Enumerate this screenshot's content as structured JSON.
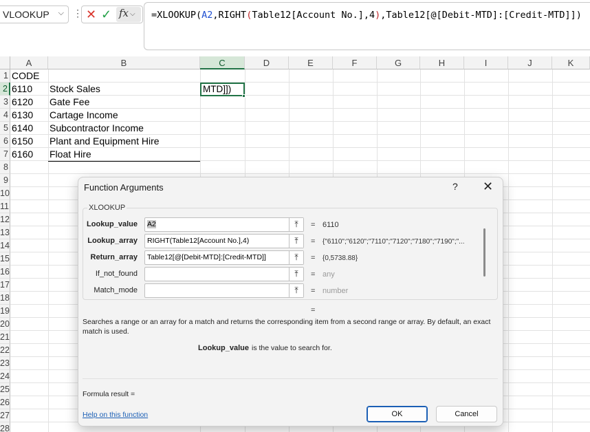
{
  "formula_bar": {
    "name_box": "VLOOKUP",
    "fx_label": "fx",
    "formula": {
      "p1": "=XLOOKUP(",
      "p2": "A2",
      "p3": ",RIGHT",
      "p4": "(",
      "p5": "Table12[Account No.],4",
      "p6": ")",
      "p7": ",Table12[@[Debit-MTD]:[Credit-MTD]])"
    }
  },
  "columns": [
    "A",
    "B",
    "C",
    "D",
    "E",
    "F",
    "G",
    "H",
    "I",
    "J",
    "K"
  ],
  "rows": [
    "1",
    "2",
    "3",
    "4",
    "5",
    "6",
    "7",
    "8",
    "9",
    "10",
    "11",
    "12",
    "13",
    "14",
    "15",
    "16",
    "17",
    "18",
    "19",
    "20",
    "21",
    "22",
    "23",
    "24",
    "25",
    "26",
    "27",
    "28"
  ],
  "cells": {
    "a1": "CODE",
    "codes": [
      "6110",
      "6120",
      "6130",
      "6140",
      "6150",
      "6160"
    ],
    "names": [
      "Stock Sales",
      "Gate Fee",
      "Cartage Income",
      "Subcontractor Income",
      "Plant and Equipment Hire",
      "Float Hire"
    ],
    "c2_editing": "MTD]])"
  },
  "dialog": {
    "title": "Function Arguments",
    "help": "?",
    "close": "✕",
    "function_name": "XLOOKUP",
    "args": [
      {
        "label": "Lookup_value",
        "value": "A2",
        "result": "6110"
      },
      {
        "label": "Lookup_array",
        "value": "RIGHT(Table12[Account No.],4)",
        "result": "{\"6110\";\"6120\";\"7110\";\"7120\";\"7180\";\"7190\";\"..."
      },
      {
        "label": "Return_array",
        "value": "Table12[@[Debit-MTD]:[Credit-MTD]]",
        "result": "{0,5738.88}"
      },
      {
        "label": "If_not_found",
        "value": "",
        "result": "any"
      },
      {
        "label": "Match_mode",
        "value": "",
        "result": "number"
      }
    ],
    "equals": "=",
    "description": "Searches a range or an array for a match and returns the corresponding item from a second range or array. By default, an exact match is used.",
    "arg_desc_name": "Lookup_value",
    "arg_desc_text": "is the value to search for.",
    "formula_result": "Formula result =",
    "help_link": "Help on this function",
    "ok": "OK",
    "cancel": "Cancel"
  },
  "icons": [
    "chevron-down-icon",
    "cancel-x-icon",
    "enter-check-icon",
    "fx-icon",
    "collapse-dialog-icon",
    "close-icon"
  ],
  "colors": {
    "accent_green": "#217346",
    "ref_blue": "#1f4fd1",
    "paren_red": "#c0282b",
    "link_blue": "#1b5fb5"
  }
}
